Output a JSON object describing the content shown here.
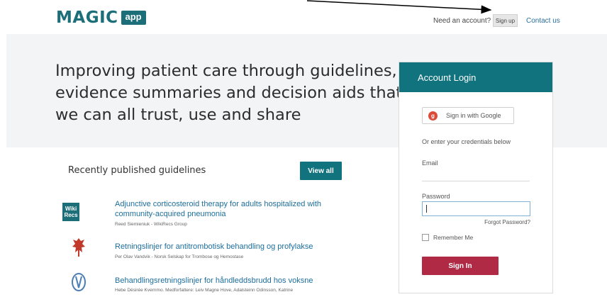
{
  "header": {
    "logo_text": "MAGIC",
    "logo_badge": "app",
    "need_account": "Need an account?",
    "signup": "Sign up",
    "contact": "Contact us"
  },
  "hero": {
    "lines": [
      "Improving patient care through guidelines,",
      "evidence summaries and decision aids that",
      "we can all trust, use and share"
    ]
  },
  "login": {
    "title": "Account Login",
    "google_label": "Sign in with Google",
    "or_text": "Or enter your credentials below",
    "email_label": "Email",
    "password_label": "Password",
    "forgot": "Forgot Password?",
    "remember": "Remember Me",
    "signin": "Sign In"
  },
  "guidelines": {
    "heading": "Recently published guidelines",
    "view_all": "View all",
    "items": [
      {
        "title": "Adjunctive corticosteroid therapy for adults hospitalized with community-acquired pneumonia",
        "meta": "Reed Siemieniuk - WikiRecs Group",
        "icon": "wikirecs-logo",
        "icon_line1": "Wiki",
        "icon_line2": "Recs"
      },
      {
        "title": "Retningslinjer for antitrombotisk behandling og profylakse",
        "meta": "Per Olav Vandvik - Norsk Selskap for Trombose og Hemostase",
        "icon": "society-crest-logo"
      },
      {
        "title": "Behandlingsretningslinjer for håndleddsbrudd hos voksne",
        "meta": "Hebe Désirée Kvernmo. Medforfattere: Leiv Magne Hove, Adalsteinn Odinsson, Katrine",
        "icon": "society-emblem-logo"
      }
    ]
  },
  "colors": {
    "brand": "#1c6e78",
    "signin": "#b02a45"
  }
}
